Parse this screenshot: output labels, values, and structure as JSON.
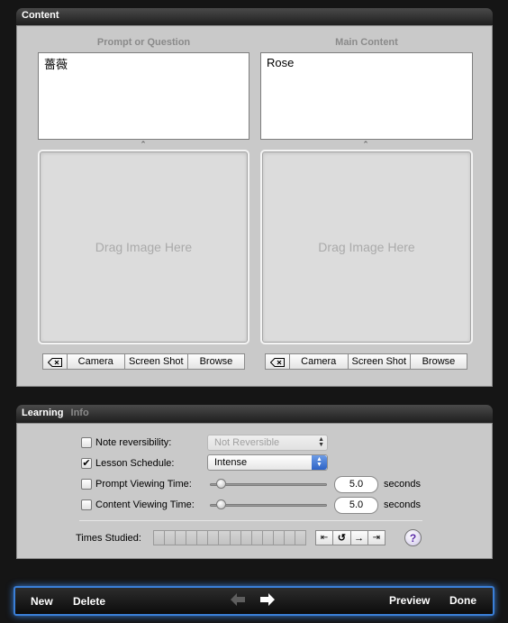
{
  "content_panel": {
    "title": "Content",
    "prompt": {
      "label": "Prompt or Question",
      "text": "薔薇",
      "drop_hint": "Drag Image Here",
      "buttons": {
        "clear_icon": "delete-left-icon",
        "camera": "Camera",
        "screenshot": "Screen Shot",
        "browse": "Browse"
      }
    },
    "main": {
      "label": "Main Content",
      "text": "Rose",
      "drop_hint": "Drag Image Here",
      "buttons": {
        "clear_icon": "delete-left-icon",
        "camera": "Camera",
        "screenshot": "Screen Shot",
        "browse": "Browse"
      }
    }
  },
  "learning_panel": {
    "tabs": [
      {
        "label": "Learning",
        "active": true
      },
      {
        "label": "Info",
        "active": false
      }
    ],
    "note_reversibility": {
      "label": "Note reversibility:",
      "checked": false,
      "value": "Not Reversible",
      "enabled": false
    },
    "lesson_schedule": {
      "label": "Lesson Schedule:",
      "checked": true,
      "value": "Intense",
      "enabled": true
    },
    "prompt_viewing_time": {
      "label": "Prompt Viewing Time:",
      "checked": false,
      "value": "5.0",
      "unit": "seconds"
    },
    "content_viewing_time": {
      "label": "Content Viewing Time:",
      "checked": false,
      "value": "5.0",
      "unit": "seconds"
    },
    "times_studied": {
      "label": "Times Studied:",
      "count": 0,
      "max": 14
    },
    "nav_icons": [
      "first-icon",
      "reset-icon",
      "next-icon",
      "last-icon"
    ],
    "help_label": "?"
  },
  "bottom_toolbar": {
    "new_label": "New",
    "delete_label": "Delete",
    "preview_label": "Preview",
    "done_label": "Done"
  },
  "colors": {
    "accent_glow": "#3a7fd8",
    "selected_blue": "#2d63c6",
    "help_purple": "#5a2aa8"
  }
}
